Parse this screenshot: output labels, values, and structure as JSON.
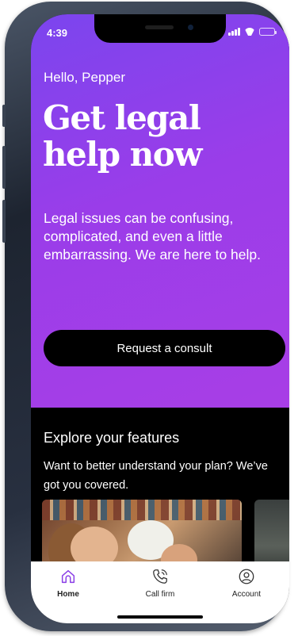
{
  "status_bar": {
    "time": "4:39"
  },
  "hero": {
    "greeting": "Hello, Pepper",
    "headline": "Get legal help now",
    "intro": "Legal issues can be confusing, complicated, and even a little embarrassing. We are here to help.",
    "cta_label": "Request a consult"
  },
  "features": {
    "title": "Explore your features",
    "subtitle": "Want to better understand your plan? We’ve got you covered.",
    "cards": [
      {
        "image": "family-photo"
      },
      {
        "image": "dark-texture-photo"
      }
    ]
  },
  "tab_bar": {
    "items": [
      {
        "label": "Home",
        "icon": "home-icon",
        "active": true
      },
      {
        "label": "Call firm",
        "icon": "phone-icon",
        "active": false
      },
      {
        "label": "Account",
        "icon": "account-icon",
        "active": false
      }
    ]
  },
  "colors": {
    "hero_gradient_start": "#7b45ee",
    "hero_gradient_end": "#a83ee6",
    "accent": "#8a3ee6",
    "cta_bg": "#000000"
  }
}
